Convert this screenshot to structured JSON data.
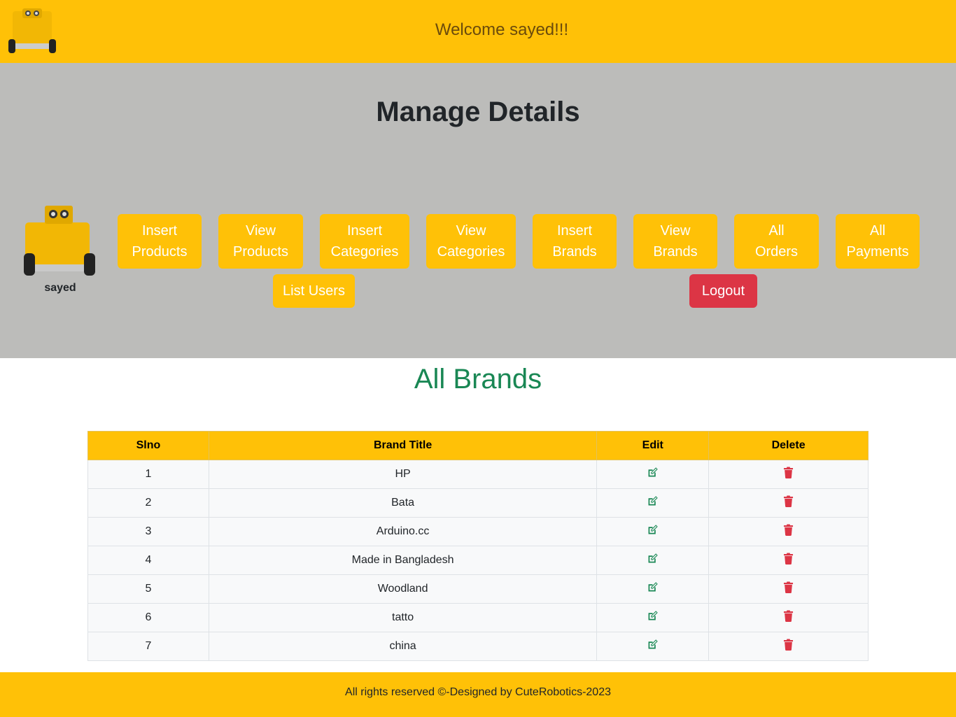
{
  "header": {
    "welcome_text": "Welcome sayed!!!",
    "logo_icon": "robot-logo-icon"
  },
  "manage": {
    "title": "Manage Details",
    "admin_name": "sayed",
    "buttons": [
      {
        "line1": "Insert",
        "line2": "Products"
      },
      {
        "line1": "View",
        "line2": "Products"
      },
      {
        "line1": "Insert",
        "line2": "Categories"
      },
      {
        "line1": "View",
        "line2": "Categories"
      },
      {
        "line1": "Insert",
        "line2": "Brands"
      },
      {
        "line1": "View",
        "line2": "Brands"
      },
      {
        "line1": "All",
        "line2": "Orders"
      },
      {
        "line1": "All",
        "line2": "Payments"
      }
    ],
    "list_users": "List Users",
    "logout": "Logout"
  },
  "brands": {
    "title": "All Brands",
    "columns": [
      "Slno",
      "Brand Title",
      "Edit",
      "Delete"
    ],
    "rows": [
      {
        "slno": "1",
        "title": "HP"
      },
      {
        "slno": "2",
        "title": "Bata"
      },
      {
        "slno": "3",
        "title": "Arduino.cc"
      },
      {
        "slno": "4",
        "title": "Made in Bangladesh"
      },
      {
        "slno": "5",
        "title": "Woodland"
      },
      {
        "slno": "6",
        "title": "tatto"
      },
      {
        "slno": "7",
        "title": "china"
      }
    ]
  },
  "footer": {
    "text": "All rights reserved ©-Designed by CuteRobotics-2023"
  },
  "colors": {
    "accent": "#ffc107",
    "danger": "#dc3545",
    "success": "#198754",
    "section_bg": "#bcbcba"
  }
}
